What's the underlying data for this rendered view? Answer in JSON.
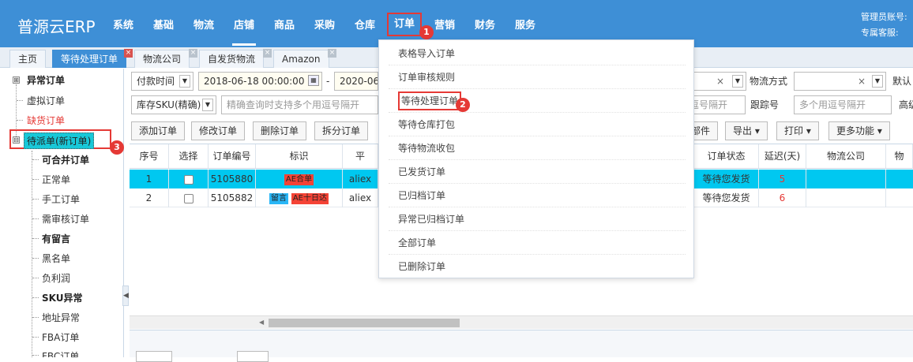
{
  "brand": "普源云ERP",
  "nav": [
    "系统",
    "基础",
    "物流",
    "店铺",
    "商品",
    "采购",
    "仓库",
    "订单",
    "营销",
    "财务",
    "服务"
  ],
  "admin": {
    "line1": "管理员账号:",
    "line2": "专属客服:"
  },
  "markers": [
    "1",
    "2",
    "3"
  ],
  "tabs": [
    "主页",
    "等待处理订单",
    "物流公司",
    "自发货物流",
    "Amazon"
  ],
  "sidebar": {
    "groups": [
      {
        "label": "异常订单",
        "expander": "⊞"
      },
      {
        "label": "虚拟订单"
      },
      {
        "label": "缺货订单"
      },
      {
        "label": "待派单(新订单)",
        "expander": "⊟"
      }
    ],
    "children": [
      "可合并订单",
      "正常单",
      "手工订单",
      "需审核订单",
      "有留言",
      "黑名单",
      "负利润",
      "SKU异常",
      "地址异常",
      "FBA订单",
      "FBC订单"
    ]
  },
  "filters": {
    "pay_time_select": "付款时间",
    "date_start": "2018-06-18 00:00:00",
    "date_sep": "-",
    "date_end": "2020-06",
    "stock_sku_select": "库存SKU(精确)",
    "stock_sku_placeholder": "精确查询时支持多个用逗号隔开",
    "clear_x": "×",
    "logistics_label": "物流方式",
    "default_select": "默认",
    "comma_placeholder_partial": "逗号隔开",
    "tracking_label": "跟踪号",
    "tracking_placeholder": "多个用逗号隔开",
    "advanced": "高级"
  },
  "toolbar": {
    "add": "添加订单",
    "edit": "修改订单",
    "delete": "删除订单",
    "split": "拆分订单",
    "parts_partial": "部件",
    "export": "导出",
    "print": "打印",
    "more": "更多功能"
  },
  "table": {
    "headers": [
      "序号",
      "选择",
      "订单编号",
      "标识",
      "平",
      "订单状态",
      "延迟(天)",
      "物流公司",
      "物"
    ],
    "rows": [
      {
        "no": "1",
        "order": "5105880",
        "tags": [
          {
            "text": "AE合单",
            "color": "#f44336"
          }
        ],
        "platform": "aliex",
        "status": "等待您发货",
        "delay": "5",
        "selected": true
      },
      {
        "no": "2",
        "order": "5105882",
        "tags": [
          {
            "text": "留言",
            "color": "#29b6f6"
          },
          {
            "text": "AE十日达",
            "color": "#f44336"
          }
        ],
        "platform": "aliex",
        "status": "等待您发货",
        "delay": "6",
        "selected": false
      }
    ]
  },
  "dropdown": [
    "表格导入订单",
    "订单审核规则",
    "等待处理订单",
    "等待仓库打包",
    "等待物流收包",
    "已发货订单",
    "已归档订单",
    "异常已归档订单",
    "全部订单",
    "已删除订单"
  ],
  "colors": {
    "nav_bg": "#3e8fd6",
    "highlight": "#e53935",
    "row_selected": "#00c8f0",
    "active_group_bg": "#18c8d8"
  }
}
